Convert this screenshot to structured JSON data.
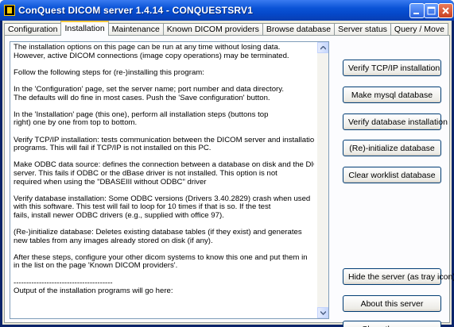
{
  "window": {
    "title": "ConQuest DICOM server 1.4.14 - CONQUESTSRV1"
  },
  "tabs": [
    {
      "label": "Configuration"
    },
    {
      "label": "Installation"
    },
    {
      "label": "Maintenance"
    },
    {
      "label": "Known DICOM providers"
    },
    {
      "label": "Browse database"
    },
    {
      "label": "Server status"
    },
    {
      "label": "Query / Move"
    }
  ],
  "active_tab": "Installation",
  "memo": {
    "text": "The installation options on this page can be run at any time without losing data.\nHowever, active DICOM connections (image copy operations) may be terminated.\n\nFollow the following steps for (re-)installing this program:\n\nIn the 'Configuration' page, set the server name; port number and data directory.\nThe defaults will do fine in most cases. Push the 'Save configuration' button.\n\nIn the 'Installation' page (this one), perform all installation steps (buttons top\nright) one by one from top to bottom.\n\nVerify TCP/IP installation: tests communication between the DICOM server and installation\nprograms. This will fail if TCP/IP is not installed on this PC.\n\nMake ODBC data source: defines the connection between a database on disk and the DICOM\nserver. This fails if ODBC or the dBase driver is not installed. This option is not\nrequired when using the \"DBASEIII without ODBC\" driver\n\nVerify database installation: Some ODBC versions (Drivers 3.40.2829) crash when used\nwith this software. This test will fail to loop for 10 times if that is so. If the test\nfails, install newer ODBC drivers (e.g., supplied with office 97).\n\n(Re-)initialize database: Deletes existing database tables (if they exist) and generates\nnew tables from any images already stored on disk (if any).\n\nAfter these steps, configure your other dicom systems to know this one and put them in\nin the list on the page 'Known DICOM providers'.\n\n---------------------------------------\nOutput of the installation programs will go here:"
  },
  "buttons": {
    "verify_tcpip": "Verify TCP/IP installation",
    "make_mysql": "Make mysql database",
    "verify_database": "Verify database installation",
    "reinit_database": "(Re)-initialize database",
    "clear_worklist": "Clear worklist database",
    "hide_server": "Hide the server (as tray icon)",
    "about_server": "About this server",
    "close_server": "Close the server"
  }
}
